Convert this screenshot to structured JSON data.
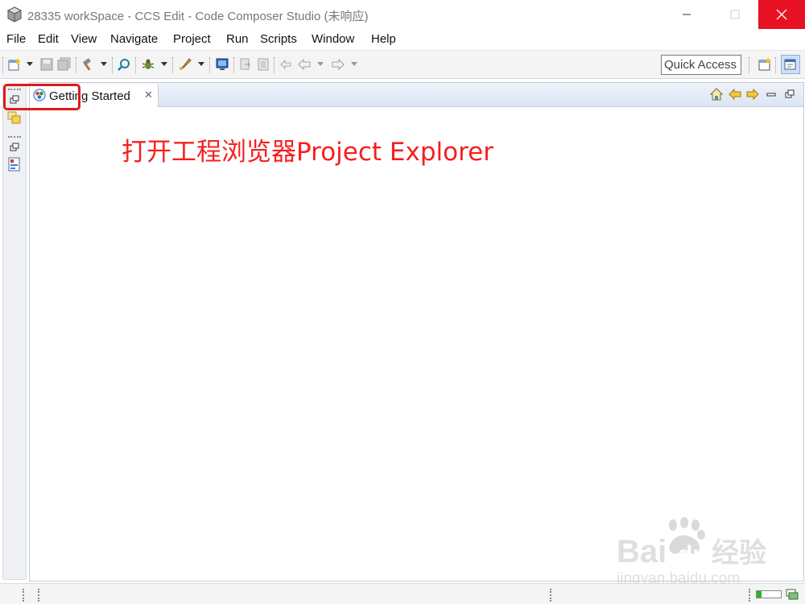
{
  "window": {
    "title": "28335 workSpace - CCS Edit - Code Composer Studio (未响应)",
    "close_color": "#e81123"
  },
  "menu": [
    {
      "label": "File"
    },
    {
      "label": "Edit"
    },
    {
      "label": "View"
    },
    {
      "label": "Navigate"
    },
    {
      "label": "Project"
    },
    {
      "label": "Run"
    },
    {
      "label": "Scripts"
    },
    {
      "label": "Window"
    },
    {
      "label": "Help"
    }
  ],
  "toolbar": {
    "quick_access_label": "Quick Access",
    "icons": [
      "new-icon",
      "save-icon",
      "save-all-icon",
      "build-icon",
      "search-icon",
      "debug-icon",
      "flash-icon",
      "terminal-icon",
      "prev-edit-icon",
      "back-icon",
      "forward-icon",
      "open-perspective-icon",
      "ccs-edit-perspective-icon"
    ]
  },
  "editor": {
    "tab_label": "Getting Started",
    "annotation": "打开工程浏览器Project Explorer",
    "annotation_color": "#f51f1f",
    "highlight_color": "#e01a1a"
  },
  "watermark": {
    "brand": "Bai du 经验",
    "url": "jingyan.baidu.com"
  },
  "status": {
    "heap_fraction": 0.2
  }
}
